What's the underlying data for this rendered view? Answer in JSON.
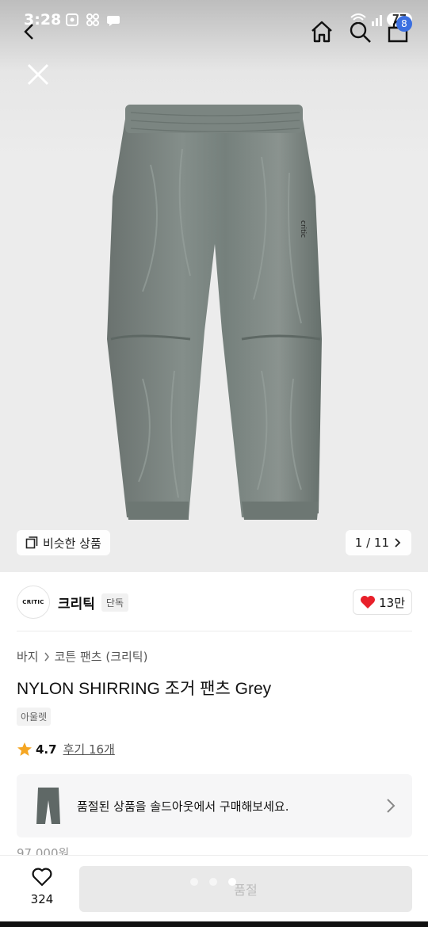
{
  "status_bar": {
    "time": "3:28",
    "battery": "77",
    "cart_badge": "8"
  },
  "hero": {
    "similar_label": "비슷한 상품",
    "pager": "1 / 11",
    "brand_print": "critic"
  },
  "brand": {
    "logo_text": "CRITIC",
    "name": "크리틱",
    "tag": "단독",
    "likes": "13만"
  },
  "breadcrumb": {
    "items": [
      "바지",
      "코튼 팬츠 (크리틱)"
    ]
  },
  "product": {
    "title": "NYLON SHIRRING 조거 팬츠 Grey",
    "tag": "아울렛",
    "rating": "4.7",
    "reviews": "후기 16개",
    "price_peek": "97,000원"
  },
  "soldout_notice": {
    "text": "품절된 상품을 솔드아웃에서 구매해보세요."
  },
  "bottom_bar": {
    "wish_count": "324",
    "buy_label": "품절"
  },
  "colors": {
    "heart": "#e8202a",
    "star": "#f5a623",
    "badge": "#3b6fe0",
    "pants": "#737d79"
  },
  "icons": [
    "back-icon",
    "home-icon",
    "search-icon",
    "cart-icon",
    "close-icon",
    "similar-icon",
    "chevron-right-icon",
    "heart-icon",
    "star-icon"
  ]
}
